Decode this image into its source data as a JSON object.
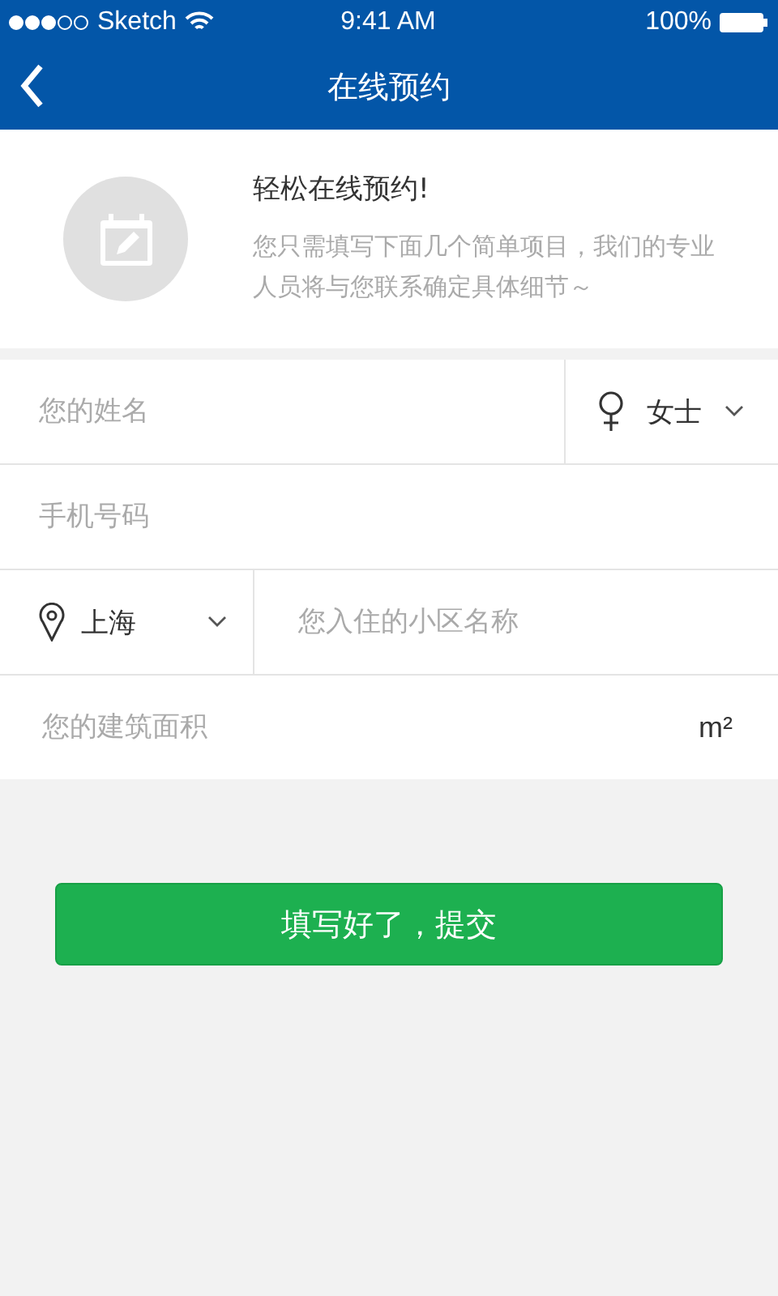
{
  "status_bar": {
    "carrier": "Sketch",
    "time": "9:41 AM",
    "battery": "100%"
  },
  "nav": {
    "title": "在线预约"
  },
  "intro": {
    "title": "轻松在线预约!",
    "text": "您只需填写下面几个简单项目，我们的专业人员将与您联系确定具体细节～"
  },
  "form": {
    "name": {
      "placeholder": "您的姓名"
    },
    "gender": {
      "value": "女士"
    },
    "phone": {
      "placeholder": "手机号码"
    },
    "city": {
      "value": "上海"
    },
    "community": {
      "placeholder": "您入住的小区名称"
    },
    "area": {
      "placeholder": "您的建筑面积",
      "unit": "m²"
    }
  },
  "submit": {
    "label": "填写好了，提交"
  }
}
